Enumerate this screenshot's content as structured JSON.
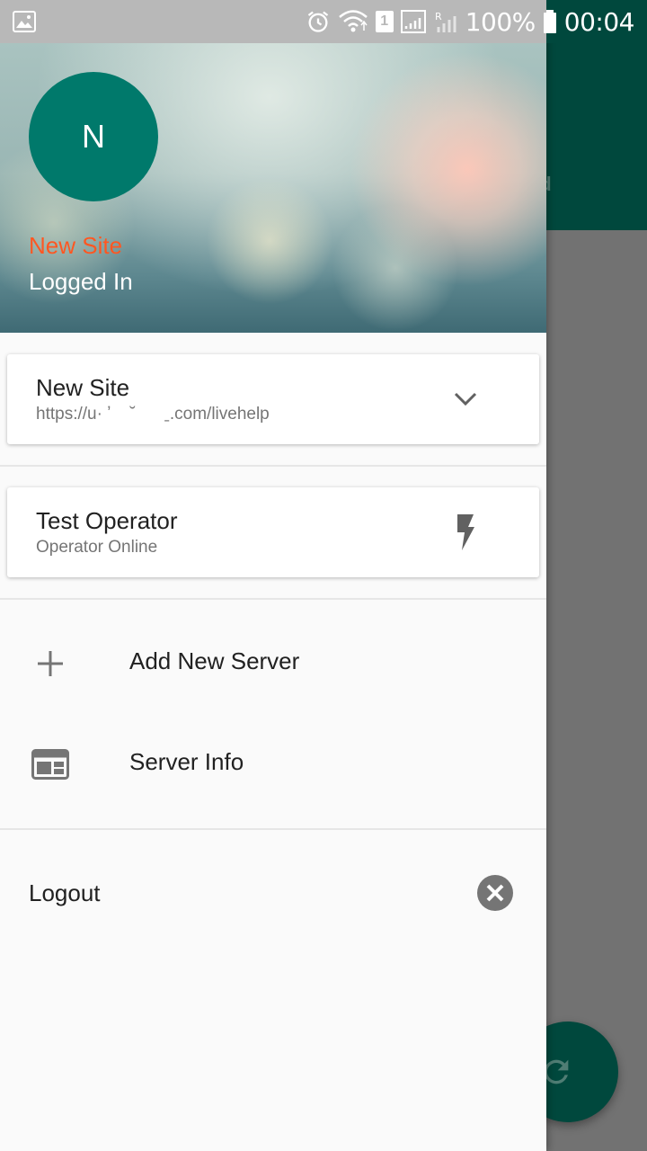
{
  "status_bar": {
    "battery": "100%",
    "time": "00:04",
    "sim_badge": "1"
  },
  "background": {
    "toolbar_text": "ed"
  },
  "drawer": {
    "header": {
      "avatar_letter": "N",
      "site_name": "New Site",
      "login_status": "Logged In"
    },
    "site_card": {
      "title": "New Site",
      "url": "https://u· ʼ    ˘      ˍ.com/livehelp"
    },
    "operator_card": {
      "name": "Test Operator",
      "status": "Operator Online"
    },
    "menu": {
      "add_server_label": "Add New Server",
      "server_info_label": "Server Info"
    },
    "logout_label": "Logout"
  },
  "colors": {
    "accent": "#ff5722",
    "primary_dark": "#00483d",
    "avatar": "#00796b"
  }
}
